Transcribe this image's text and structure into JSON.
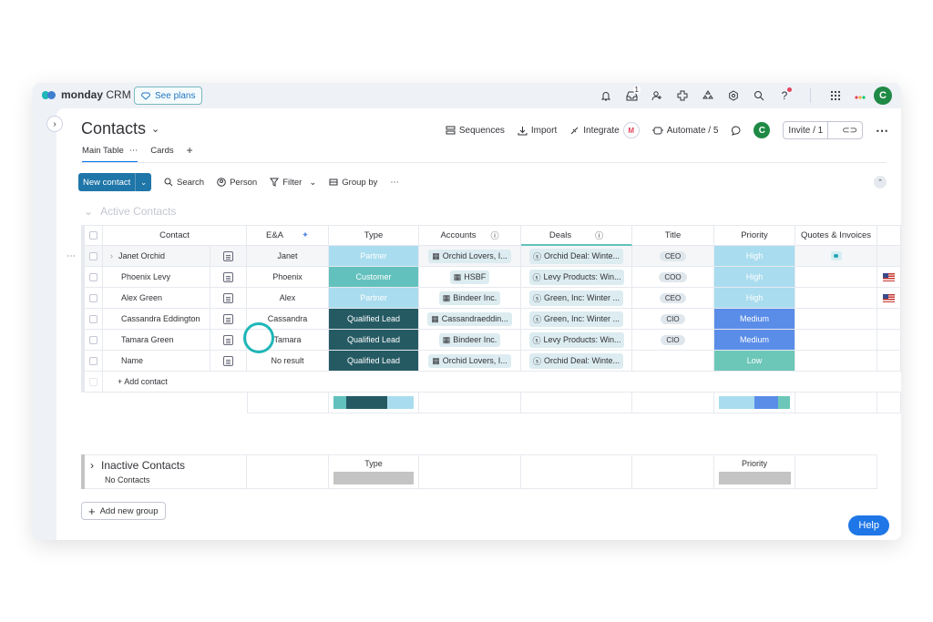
{
  "app": {
    "brand": "monday",
    "brand_sub": "CRM",
    "see_plans": "See plans"
  },
  "topbar": {
    "inbox_count": "1",
    "help_icon": "?",
    "avatar": "C",
    "icons": [
      "bell-icon",
      "inbox-icon",
      "invite-icon",
      "integrations-icon",
      "apps-icon",
      "settings-icon",
      "search-icon",
      "help-icon",
      "grid-icon"
    ]
  },
  "page": {
    "title": "Contacts"
  },
  "actions": {
    "sequences": "Sequences",
    "import": "Import",
    "integrate": "Integrate",
    "integrate_badge": "M",
    "automate": "Automate / 5",
    "avatar": "C",
    "invite": "Invite / 1"
  },
  "tabs": {
    "main": "Main Table",
    "cards": "Cards",
    "add": "+"
  },
  "toolbar": {
    "new_contact": "New contact",
    "search": "Search",
    "person": "Person",
    "filter": "Filter",
    "group_by": "Group by"
  },
  "group": {
    "title": "Active Contacts",
    "add_contact": "+ Add contact"
  },
  "columns": {
    "contact": "Contact",
    "ea": "E&A",
    "type": "Type",
    "accounts": "Accounts",
    "deals": "Deals",
    "title": "Title",
    "priority": "Priority",
    "quotes": "Quotes & Invoices"
  },
  "rows": [
    {
      "name": "Janet Orchid",
      "ea": "Janet",
      "type": "Partner",
      "account": "Orchid Lovers, I...",
      "deal": "Orchid Deal: Winte...",
      "title": "CEO",
      "priority": "High",
      "has_quote": true,
      "flag": false
    },
    {
      "name": "Phoenix Levy",
      "ea": "Phoenix",
      "type": "Customer",
      "account": "HSBF",
      "deal": "Levy Products: Win...",
      "title": "COO",
      "priority": "High",
      "has_quote": false,
      "flag": true
    },
    {
      "name": "Alex Green",
      "ea": "Alex",
      "type": "Partner",
      "account": "Bindeer Inc.",
      "deal": "Green, Inc: Winter ...",
      "title": "CEO",
      "priority": "High",
      "has_quote": false,
      "flag": true
    },
    {
      "name": "Cassandra Eddington",
      "ea": "Cassandra",
      "type": "Qualified Lead",
      "account": "Cassandraeddin...",
      "deal": "Green, Inc: Winter ...",
      "title": "CIO",
      "priority": "Medium",
      "has_quote": false,
      "flag": false
    },
    {
      "name": "Tamara Green",
      "ea": "Tamara",
      "type": "Qualified Lead",
      "account": "Bindeer Inc.",
      "deal": "Levy Products: Win...",
      "title": "CIO",
      "priority": "Medium",
      "has_quote": false,
      "flag": false
    },
    {
      "name": "Name",
      "ea": "No result",
      "type": "Qualified Lead",
      "account": "Orchid Lovers, I...",
      "deal": "Orchid Deal: Winte...",
      "title": "",
      "priority": "Low",
      "has_quote": false,
      "flag": false
    }
  ],
  "colors": {
    "Partner": "#a9dcee",
    "Customer": "#63c1bd",
    "Qualified Lead": "#255a63",
    "High": "#a9dcee",
    "Medium": "#5a8de8",
    "Low": "#6cc7b8"
  },
  "summary": {
    "type": [
      {
        "color": "#63c1bd",
        "pct": 16.7
      },
      {
        "color": "#255a63",
        "pct": 50
      },
      {
        "color": "#a9dcee",
        "pct": 33.3
      }
    ],
    "priority": [
      {
        "color": "#a9dcee",
        "pct": 50
      },
      {
        "color": "#5a8de8",
        "pct": 33.3
      },
      {
        "color": "#6cc7b8",
        "pct": 16.7
      }
    ]
  },
  "inactive": {
    "title": "Inactive Contacts",
    "subtitle": "No Contacts",
    "type": "Type",
    "priority": "Priority"
  },
  "add_group": "Add new group",
  "help": "Help"
}
